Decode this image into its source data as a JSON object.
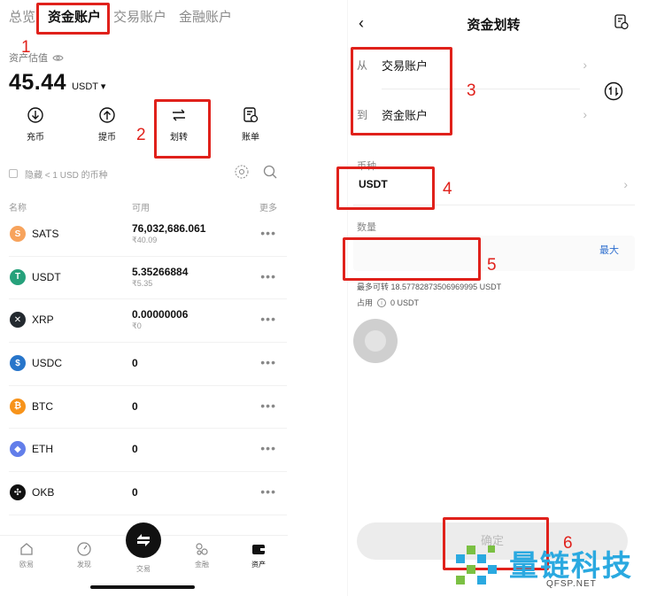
{
  "left": {
    "tabs": [
      {
        "label": "总览",
        "active": false
      },
      {
        "label": "资金账户",
        "active": true
      },
      {
        "label": "交易账户",
        "active": false
      },
      {
        "label": "金融账户",
        "active": false
      }
    ],
    "asset_label": "资产估值",
    "asset_value": "45.44",
    "asset_unit": "USDT",
    "actions": [
      {
        "label": "充币",
        "icon": "deposit-icon"
      },
      {
        "label": "提币",
        "icon": "withdraw-icon"
      },
      {
        "label": "划转",
        "icon": "transfer-icon"
      },
      {
        "label": "账单",
        "icon": "bill-icon"
      }
    ],
    "hide_small": "隐藏 < 1 USD 的币种",
    "columns": {
      "name": "名称",
      "available": "可用",
      "more": "更多"
    },
    "coins": [
      {
        "symbol": "SATS",
        "amount": "76,032,686.061",
        "fiat": "₹40.09",
        "color": "#f7a35c",
        "glyph": "S"
      },
      {
        "symbol": "USDT",
        "amount": "5.35266884",
        "fiat": "₹5.35",
        "color": "#26a17b",
        "glyph": "T"
      },
      {
        "symbol": "XRP",
        "amount": "0.00000006",
        "fiat": "₹0",
        "color": "#23292f",
        "glyph": "✕"
      },
      {
        "symbol": "USDC",
        "amount": "0",
        "fiat": "",
        "color": "#2775ca",
        "glyph": "$"
      },
      {
        "symbol": "BTC",
        "amount": "0",
        "fiat": "",
        "color": "#f7931a",
        "glyph": "₿"
      },
      {
        "symbol": "ETH",
        "amount": "0",
        "fiat": "",
        "color": "#627eea",
        "glyph": "◆"
      },
      {
        "symbol": "OKB",
        "amount": "0",
        "fiat": "",
        "color": "#111111",
        "glyph": "✣"
      }
    ],
    "more_label": "•••",
    "nav": [
      {
        "label": "欧易",
        "icon": "home-icon"
      },
      {
        "label": "发现",
        "icon": "discover-icon"
      },
      {
        "label": "交易",
        "icon": "trade-icon"
      },
      {
        "label": "金融",
        "icon": "finance-icon"
      },
      {
        "label": "资产",
        "icon": "assets-icon"
      }
    ]
  },
  "right": {
    "title": "资金划转",
    "from_prefix": "从",
    "from_account": "交易账户",
    "to_prefix": "到",
    "to_account": "资金账户",
    "currency_label": "币种",
    "currency_value": "USDT",
    "quantity_label": "数量",
    "max_label": "最大",
    "max_transferable": "最多可转 18.57782873506969995 USDT",
    "occupied_label": "占用",
    "occupied_value": "0 USDT",
    "confirm_label": "确定"
  },
  "annotations": [
    "1",
    "2",
    "3",
    "4",
    "5",
    "6"
  ],
  "watermark": {
    "brand": "量链科技",
    "site": "QFSP.NET"
  },
  "colors": {
    "annotation_red": "#e0211b",
    "link_blue": "#2f6fcf",
    "watermark_blue": "#2aa9e0"
  }
}
